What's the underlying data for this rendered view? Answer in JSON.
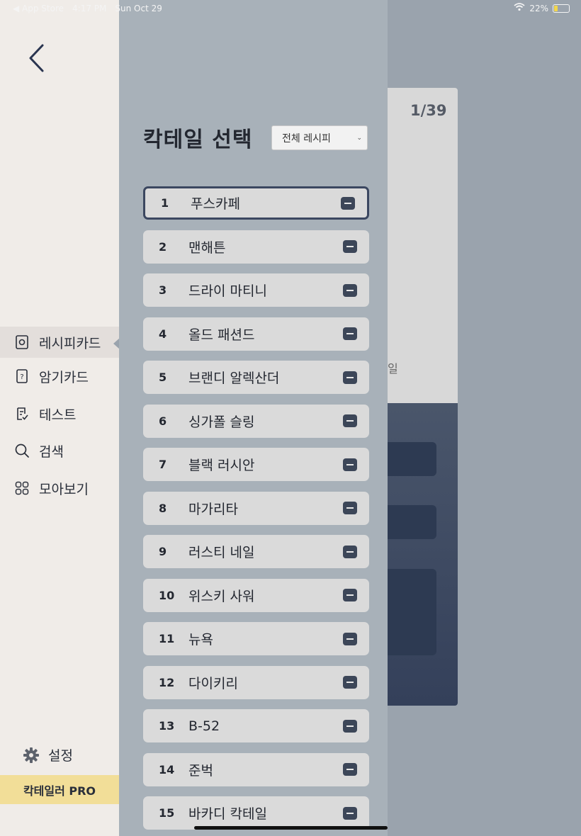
{
  "status_bar": {
    "back_app": "◀ App Store",
    "time": "4:17 PM",
    "date": "Sun Oct 29",
    "battery": "22%",
    "battery_level_percent": 22
  },
  "sidebar": {
    "back_icon": "chevron-left-icon",
    "items": [
      {
        "label": "레시피카드",
        "icon": "card-icon",
        "active": true
      },
      {
        "label": "암기카드",
        "icon": "question-card-icon",
        "active": false
      },
      {
        "label": "테스트",
        "icon": "checklist-icon",
        "active": false
      },
      {
        "label": "검색",
        "icon": "search-icon",
        "active": false
      },
      {
        "label": "모아보기",
        "icon": "grid-icon",
        "active": false
      }
    ],
    "settings_label": "설정",
    "pro_label": "칵테일러 PRO"
  },
  "panel": {
    "title": "칵테일 선택",
    "filter_value": "전체 레시피",
    "cocktails": [
      {
        "num": "1",
        "name": "푸스카페"
      },
      {
        "num": "2",
        "name": "맨해튼"
      },
      {
        "num": "3",
        "name": "드라이 마티니"
      },
      {
        "num": "4",
        "name": "올드 패션드"
      },
      {
        "num": "5",
        "name": "브랜디 알렉산더"
      },
      {
        "num": "6",
        "name": "싱가폴 슬링"
      },
      {
        "num": "7",
        "name": "블랙 러시안"
      },
      {
        "num": "8",
        "name": "마가리타"
      },
      {
        "num": "9",
        "name": "러스티 네일"
      },
      {
        "num": "10",
        "name": "위스키 사워"
      },
      {
        "num": "11",
        "name": "뉴욕"
      },
      {
        "num": "12",
        "name": "다이키리"
      },
      {
        "num": "13",
        "name": "B-52"
      },
      {
        "num": "14",
        "name": "준벅"
      },
      {
        "num": "15",
        "name": "바카디 칵테일"
      }
    ]
  },
  "card": {
    "counter": "1/39",
    "partial_text": "일"
  },
  "colors": {
    "sidebar_bg": "#f0ece8",
    "panel_bg": "#a8b1b9",
    "row_bg": "#dadada",
    "accent_dark": "#3c4658",
    "pro_bg": "#f2de98"
  }
}
